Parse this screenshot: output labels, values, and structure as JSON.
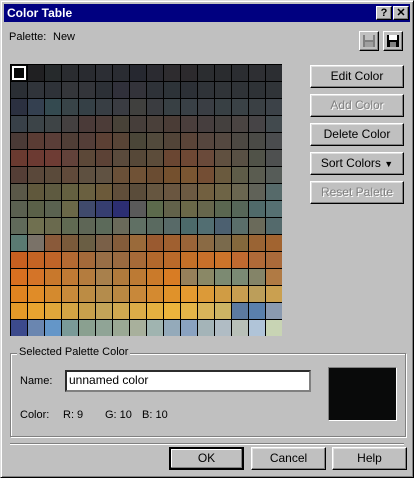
{
  "window": {
    "title": "Color Table",
    "help_glyph": "?",
    "close_glyph": "✕"
  },
  "palette": {
    "label": "Palette:",
    "name": "New"
  },
  "buttons": {
    "edit_color": "Edit Color",
    "add_color": "Add Color",
    "delete_color": "Delete Color",
    "sort_colors": "Sort Colors",
    "reset_palette": "Reset Palette",
    "ok": "OK",
    "cancel": "Cancel",
    "help": "Help"
  },
  "icons": {
    "save_disabled": "floppy-disk-disabled-icon",
    "save": "floppy-disk-icon",
    "dropdown": "triangle-down-icon"
  },
  "selected": {
    "group_label": "Selected Palette Color",
    "name_label": "Name:",
    "name_value": "unnamed color",
    "color_label": "Color:",
    "r": "R: 9",
    "g": "G: 10",
    "b": "B: 10",
    "swatch_hex": "#090a0a"
  },
  "grid_colors": [
    [
      "#090a0a",
      "#202022",
      "#262a2c",
      "#2a2c30",
      "#292b30",
      "#2c2e34",
      "#2a2c32",
      "#262830",
      "#2b2b31",
      "#2e2c2f",
      "#2c2a2d",
      "#2b2d30",
      "#2a2c2f",
      "#2b2d31",
      "#2e2f33",
      "#2c2e32"
    ],
    [
      "#2a2e34",
      "#30343a",
      "#2e3238",
      "#34363a",
      "#33353a",
      "#2c3036",
      "#30303a",
      "#33333a",
      "#2e3238",
      "#2d3338",
      "#2c3036",
      "#2f3338",
      "#303438",
      "#2f3337",
      "#2e3236",
      "#303438"
    ],
    [
      "#2b3040",
      "#344050",
      "#344a50",
      "#384448",
      "#354046",
      "#383e44",
      "#3a3c42",
      "#40403e",
      "#3a3c40",
      "#384044",
      "#394046",
      "#3a3e44",
      "#384044",
      "#3a4246",
      "#3a4044",
      "#3c4248"
    ],
    [
      "#384048",
      "#3c4448",
      "#3e4446",
      "#444040",
      "#4a3a38",
      "#4c3c38",
      "#484238",
      "#463e3a",
      "#4a403a",
      "#4a3c36",
      "#4a3e3c",
      "#463e3e",
      "#44403e",
      "#4a4442",
      "#464446",
      "#424a4e"
    ],
    [
      "#4a3a36",
      "#5a3c34",
      "#5a3e38",
      "#503e36",
      "#543e38",
      "#5c4034",
      "#584436",
      "#4a4638",
      "#524a3c",
      "#524438",
      "#5a4438",
      "#56463e",
      "#544840",
      "#4c4842",
      "#4a4a46",
      "#4a4c4e"
    ],
    [
      "#6a3a30",
      "#6c3a32",
      "#6e3c34",
      "#62423a",
      "#5c4838",
      "#5c4236",
      "#5a4a3c",
      "#564838",
      "#5c4c3a",
      "#6a4632",
      "#6e4834",
      "#6a4a3a",
      "#605040",
      "#585044",
      "#505248",
      "#4e5050"
    ],
    [
      "#543e36",
      "#5a483a",
      "#5a4a3a",
      "#604a3a",
      "#5e5040",
      "#605242",
      "#6a5038",
      "#705236",
      "#6a4c32",
      "#74502e",
      "#7a5632",
      "#744e34",
      "#6a5a3e",
      "#5e5c48",
      "#5a5c50",
      "#565c58"
    ],
    [
      "#5a5848",
      "#60583c",
      "#5e5a40",
      "#646040",
      "#6a6040",
      "#6c5a3a",
      "#604e3a",
      "#5a4c3a",
      "#665640",
      "#6a5640",
      "#6c5a42",
      "#726040",
      "#6e6446",
      "#6a6650",
      "#606258",
      "#566a6a"
    ],
    [
      "#5a6050",
      "#5a6048",
      "#5a6250",
      "#6a6848",
      "#404a6c",
      "#363e70",
      "#2c2e72",
      "#5a5a5a",
      "#5c6a4c",
      "#62624a",
      "#6a6848",
      "#66664c",
      "#5a6650",
      "#566658",
      "#506a6a",
      "#567072"
    ],
    [
      "#606a5a",
      "#707050",
      "#6a6a4e",
      "#606a52",
      "#5e6656",
      "#5c6a5a",
      "#6a6a5a",
      "#607064",
      "#5a6a60",
      "#586a68",
      "#4c6a6a",
      "#526e72",
      "#4c6070",
      "#5a6e6a",
      "#6a6a5a",
      "#546a6c"
    ],
    [
      "#5a7a72",
      "#7a7268",
      "#8a5a3a",
      "#7a5a3a",
      "#6a5e44",
      "#7a6048",
      "#845c3a",
      "#9a6a3a",
      "#9a5a30",
      "#a06030",
      "#9a6438",
      "#8a6a44",
      "#7a6a4c",
      "#84683c",
      "#9a6434",
      "#a26430"
    ],
    [
      "#c86020",
      "#c46424",
      "#c06428",
      "#b46a32",
      "#a46a3a",
      "#986e46",
      "#9a6a40",
      "#a66a38",
      "#b2682c",
      "#ba6a2a",
      "#c47028",
      "#c8702a",
      "#cc742a",
      "#c06a30",
      "#b06a38",
      "#aa6a3a"
    ],
    [
      "#d87020",
      "#d47428",
      "#c8782c",
      "#c07a34",
      "#b47c3e",
      "#a8804c",
      "#b07a3c",
      "#bc7a34",
      "#ca7a2a",
      "#d87c24",
      "#96805a",
      "#8a8866",
      "#7c8a72",
      "#7a8a74",
      "#848468",
      "#b07a44"
    ],
    [
      "#e08420",
      "#e08c28",
      "#d48a2e",
      "#c88a3a",
      "#bc8c44",
      "#b48c4c",
      "#ba8842",
      "#c8883a",
      "#d48a30",
      "#e0922a",
      "#e49a30",
      "#dc9a38",
      "#d09c44",
      "#c89e50",
      "#bc9e5a",
      "#caa050"
    ],
    [
      "#e49a28",
      "#e8a430",
      "#e0a63a",
      "#d4a444",
      "#c8a04c",
      "#c4a458",
      "#d0a850",
      "#dcac48",
      "#e4b040",
      "#ecb43c",
      "#e4b448",
      "#d8b45a",
      "#ccb464",
      "#5c7aa0",
      "#5a80ac",
      "#8a9ab0"
    ],
    [
      "#3c4a8c",
      "#6a86b0",
      "#6496c8",
      "#7a9a98",
      "#8aa090",
      "#90a496",
      "#9aa894",
      "#a8b09c",
      "#a0b4b0",
      "#94aaba",
      "#8aa2c0",
      "#a4b4b8",
      "#b0bcc4",
      "#b8c0b8",
      "#b0c4d8",
      "#c8d4b4"
    ]
  ]
}
